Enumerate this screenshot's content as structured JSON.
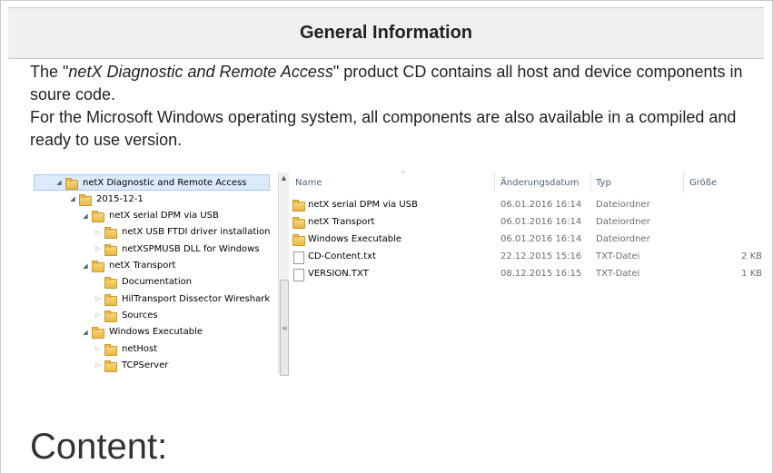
{
  "header": {
    "title": "General Information"
  },
  "intro": {
    "p1_prefix": "The \"",
    "p1_product": "netX Diagnostic and Remote Access",
    "p1_suffix": "\" product CD contains all host and device components in soure code.",
    "p2": "For the Microsoft Windows operating system, all components are also available in a compiled and ready to use version."
  },
  "explorer": {
    "tree": [
      {
        "label": "netX Diagnostic and Remote Access",
        "level": 0,
        "state": "expanded",
        "folder": true,
        "selected": true
      },
      {
        "label": "2015-12-1",
        "level": 1,
        "state": "expanded",
        "folder": true
      },
      {
        "label": "netX serial DPM via USB",
        "level": 2,
        "state": "expanded",
        "folder": true
      },
      {
        "label": "netX USB FTDI driver installation",
        "level": 3,
        "state": "collapsed",
        "folder": true
      },
      {
        "label": "netXSPMUSB DLL for Windows",
        "level": 3,
        "state": "collapsed",
        "folder": true
      },
      {
        "label": "netX Transport",
        "level": 2,
        "state": "expanded",
        "folder": true
      },
      {
        "label": "Documentation",
        "level": 3,
        "state": "none",
        "folder": true
      },
      {
        "label": "HilTransport Dissector Wireshark",
        "level": 3,
        "state": "collapsed",
        "folder": true
      },
      {
        "label": "Sources",
        "level": 3,
        "state": "collapsed",
        "folder": true
      },
      {
        "label": "Windows Executable",
        "level": 2,
        "state": "expanded",
        "folder": true
      },
      {
        "label": "netHost",
        "level": 3,
        "state": "collapsed",
        "folder": true
      },
      {
        "label": "TCPServer",
        "level": 3,
        "state": "collapsed",
        "folder": true
      }
    ],
    "columns": {
      "name": "Name",
      "date": "Änderungsdatum",
      "type": "Typ",
      "size": "Größe"
    },
    "files": [
      {
        "name": "netX serial DPM via USB",
        "date": "06.01.2016 16:14",
        "type": "Dateiordner",
        "size": "",
        "icon": "folder-icon"
      },
      {
        "name": "netX Transport",
        "date": "06.01.2016 16:14",
        "type": "Dateiordner",
        "size": "",
        "icon": "folder-icon"
      },
      {
        "name": "Windows Executable",
        "date": "06.01.2016 16:14",
        "type": "Dateiordner",
        "size": "",
        "icon": "folder-icon"
      },
      {
        "name": "CD-Content.txt",
        "date": "22.12.2015 15:16",
        "type": "TXT-Datei",
        "size": "2 KB",
        "icon": "text-file-icon"
      },
      {
        "name": "VERSION.TXT",
        "date": "08.12.2015 16:15",
        "type": "TXT-Datei",
        "size": "1 KB",
        "icon": "text-file-icon"
      }
    ]
  },
  "content": {
    "title": "Content:"
  }
}
